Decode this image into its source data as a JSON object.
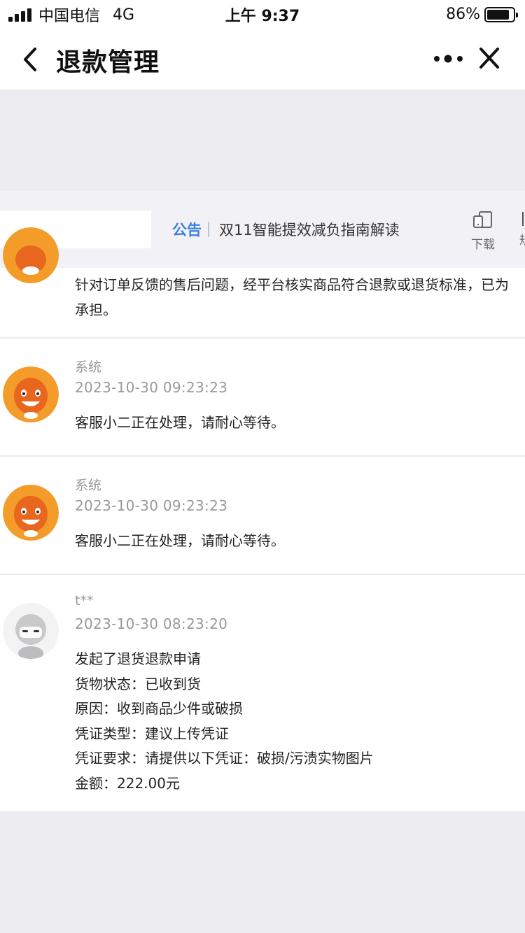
{
  "status_bar": {
    "carrier": "中国电信",
    "network": "4G",
    "time": "上午 9:37",
    "battery": "86%",
    "battery_level": 0.86
  },
  "nav": {
    "title": "退款管理"
  },
  "notice": {
    "tag": "公告",
    "text": "双11智能提效减负指南解读",
    "download_label": "下载",
    "side_label": "规"
  },
  "messages": [
    {
      "lines": [
        "针对订单反馈的售后问题，经平台核实商品符合退款或退货标准，已为",
        "承担。"
      ]
    },
    {
      "sender": "系统",
      "timestamp": "2023-10-30 09:23:23",
      "lines": [
        "客服小二正在处理，请耐心等待。"
      ]
    },
    {
      "sender": "系统",
      "timestamp": "2023-10-30 09:23:23",
      "lines": [
        "客服小二正在处理，请耐心等待。"
      ]
    },
    {
      "sender": "t**",
      "timestamp": "2023-10-30 08:23:20",
      "lines": [
        "发起了退货退款申请",
        "货物状态：已收到货",
        "原因：收到商品少件或破损",
        "凭证类型：建议上传凭证",
        "凭证要求：请提供以下凭证：破损/污渍实物图片",
        "金额：222.00元"
      ]
    }
  ],
  "colors": {
    "accent": "#3d7ee9",
    "avatar_orange": "#f39c2a",
    "background": "#f0f0f4"
  }
}
